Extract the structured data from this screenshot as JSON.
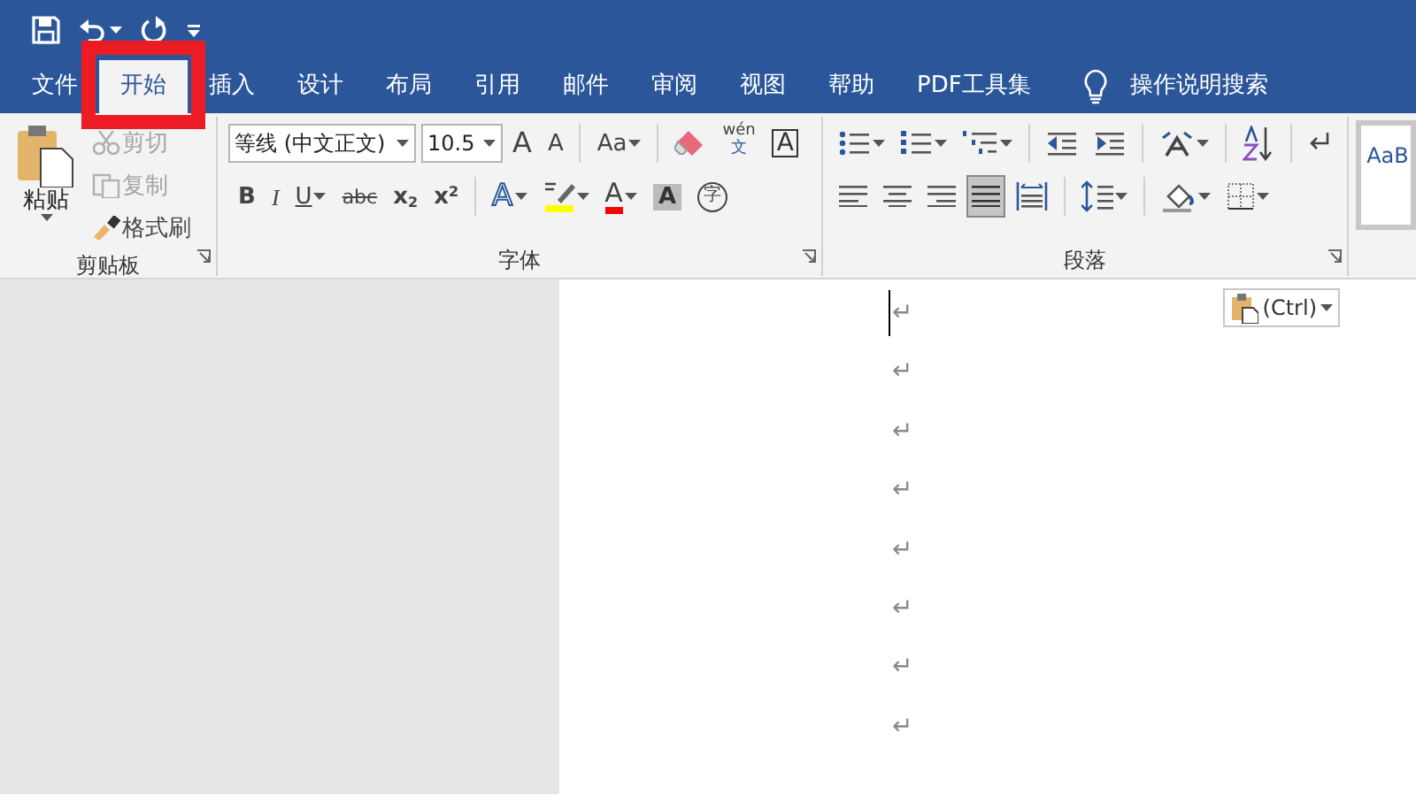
{
  "quick_access": [
    {
      "kind": "save"
    },
    {
      "kind": "undo",
      "dropdown": true
    },
    {
      "kind": "redo"
    },
    {
      "kind": "customize"
    }
  ],
  "tabs": [
    {
      "label": "文件",
      "selected": false,
      "highlighted": false
    },
    {
      "label": "开始",
      "selected": true,
      "highlighted": true
    },
    {
      "label": "插入",
      "selected": false,
      "highlighted": false
    },
    {
      "label": "设计",
      "selected": false,
      "highlighted": false
    },
    {
      "label": "布局",
      "selected": false,
      "highlighted": false
    },
    {
      "label": "引用",
      "selected": false,
      "highlighted": false
    },
    {
      "label": "邮件",
      "selected": false,
      "highlighted": false
    },
    {
      "label": "审阅",
      "selected": false,
      "highlighted": false
    },
    {
      "label": "视图",
      "selected": false,
      "highlighted": false
    },
    {
      "label": "帮助",
      "selected": false,
      "highlighted": false
    },
    {
      "label": "PDF工具集",
      "selected": false,
      "highlighted": false
    }
  ],
  "tell_me": {
    "text": "操作说明搜索"
  },
  "clipboard": {
    "label": "剪贴板",
    "paste": {
      "label": "粘贴"
    },
    "items": [
      {
        "kind": "cut",
        "label": "剪切",
        "disabled": true
      },
      {
        "kind": "copy",
        "label": "复制",
        "disabled": true
      },
      {
        "kind": "painter",
        "label": "格式刷",
        "disabled": false
      }
    ]
  },
  "font": {
    "label": "字体",
    "font_name": "等线 (中文正文)",
    "font_size": "10.5",
    "row1": [
      {
        "kind": "grow",
        "glyph": "A"
      },
      {
        "kind": "shrink",
        "glyph": "A"
      },
      {
        "kind": "separator"
      },
      {
        "kind": "case",
        "glyph": "Aa",
        "dropdown": true
      },
      {
        "kind": "separator"
      },
      {
        "kind": "clear"
      },
      {
        "kind": "phonetic",
        "glyph": "wén",
        "sub": "文"
      },
      {
        "kind": "border",
        "glyph": "A"
      }
    ],
    "row2": [
      {
        "kind": "bold",
        "glyph": "B"
      },
      {
        "kind": "italic",
        "glyph": "I"
      },
      {
        "kind": "underline",
        "glyph": "U",
        "dropdown": true
      },
      {
        "kind": "strike",
        "glyph": "abc"
      },
      {
        "kind": "script",
        "glyph": "x$_{2}$"
      },
      {
        "kind": "script",
        "glyph": "x$^{2}$"
      },
      {
        "kind": "separator"
      },
      {
        "kind": "effects",
        "glyph": "A",
        "dropdown": true
      },
      {
        "kind": "highlight",
        "color": "#ffff00",
        "dropdown": true
      },
      {
        "kind": "color",
        "glyph": "A",
        "color": "#ff0000",
        "dropdown": true
      },
      {
        "kind": "shading",
        "glyph": "A"
      },
      {
        "kind": "enclose",
        "glyph": "字"
      }
    ]
  },
  "paragraph": {
    "label": "段落",
    "row1": [
      {
        "kind": "bullets",
        "dropdown": true
      },
      {
        "kind": "numbering",
        "dropdown": true
      },
      {
        "kind": "multilevel",
        "dropdown": true
      },
      {
        "kind": "separator"
      },
      {
        "kind": "outdent"
      },
      {
        "kind": "indent"
      },
      {
        "kind": "separator"
      },
      {
        "kind": "asian",
        "dropdown": true
      },
      {
        "kind": "separator"
      },
      {
        "kind": "sort"
      },
      {
        "kind": "separator"
      },
      {
        "kind": "marks"
      }
    ],
    "row2": [
      {
        "kind": "align-left",
        "selected": false
      },
      {
        "kind": "align-center",
        "selected": false
      },
      {
        "kind": "align-right",
        "selected": false
      },
      {
        "kind": "justify",
        "selected": true
      },
      {
        "kind": "distribute",
        "selected": false
      },
      {
        "kind": "separator"
      },
      {
        "kind": "spacing",
        "dropdown": true
      },
      {
        "kind": "separator"
      },
      {
        "kind": "fill",
        "dropdown": true
      },
      {
        "kind": "borders",
        "dropdown": true
      }
    ]
  },
  "styles": {
    "preview": "AaB"
  },
  "document": {
    "cursor": true,
    "paste_options": {
      "label": "(Ctrl)"
    },
    "paragraph_marks": [
      "↵",
      "↵",
      "↵",
      "↵",
      "↵",
      "↵",
      "↵",
      "↵"
    ]
  }
}
